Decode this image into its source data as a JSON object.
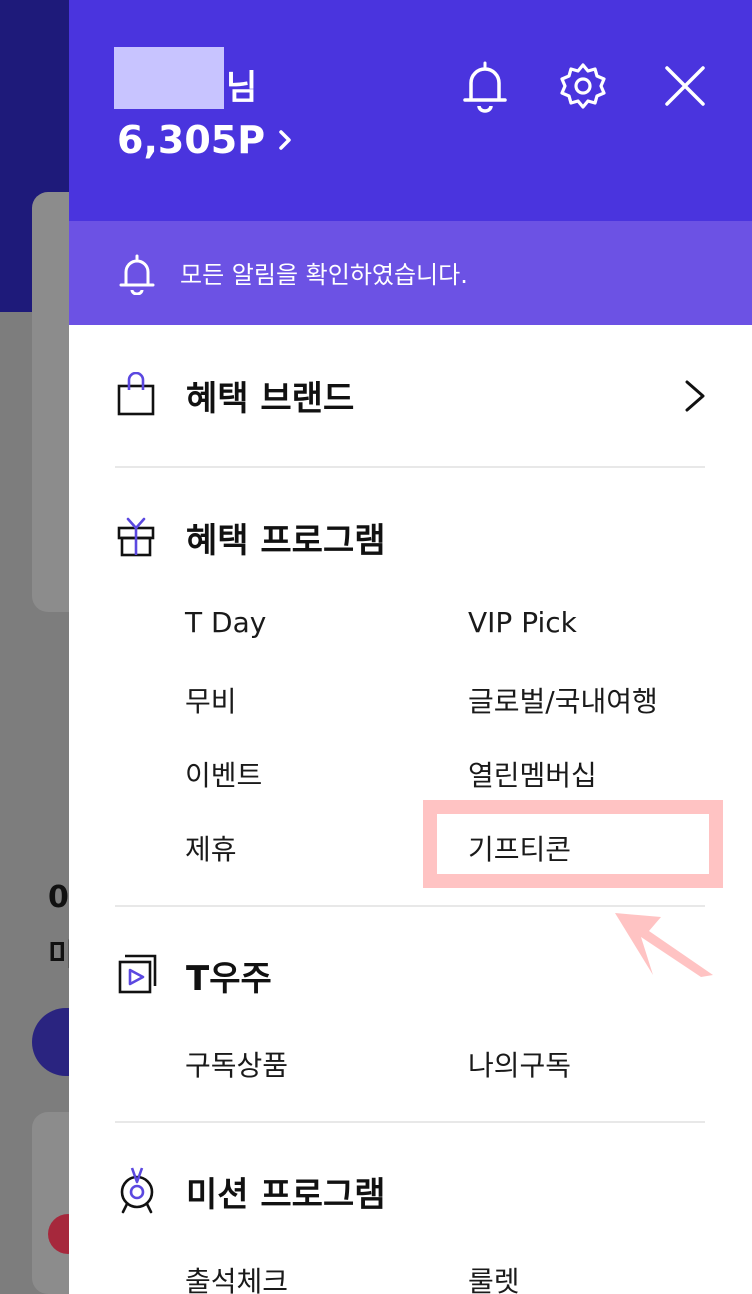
{
  "background": {
    "frag1": "0",
    "frag2": "미"
  },
  "header": {
    "user_suffix": "님",
    "points": "6,305P",
    "icons": [
      "bell-icon",
      "gear-icon",
      "close-icon"
    ]
  },
  "notice": {
    "text": "모든 알림을 확인하였습니다."
  },
  "sections": {
    "brand": {
      "title": "혜택 브랜드"
    },
    "program": {
      "title": "혜택 프로그램",
      "items": [
        "T Day",
        "VIP Pick",
        "무비",
        "글로벌/국내여행",
        "이벤트",
        "열린멤버십",
        "제휴",
        "기프티콘"
      ]
    },
    "universe": {
      "title": "T우주",
      "items": [
        "구독상품",
        "나의구독"
      ]
    },
    "mission": {
      "title": "미션 프로그램",
      "items": [
        "출석체크",
        "룰렛"
      ]
    }
  },
  "colors": {
    "header": "#4a34de",
    "notice_bar": "#6c52e4",
    "highlight": "#ffc3c3"
  }
}
